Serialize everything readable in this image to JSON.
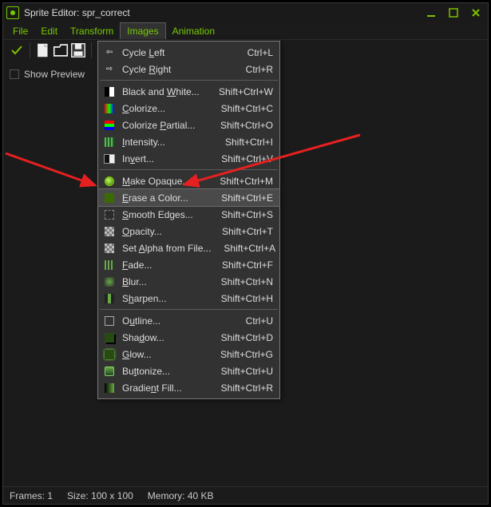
{
  "window": {
    "title": "Sprite Editor: spr_correct"
  },
  "menus": {
    "file": "File",
    "edit": "Edit",
    "transform": "Transform",
    "images": "Images",
    "animation": "Animation"
  },
  "sidebar": {
    "showPreview": "Show Preview"
  },
  "dropdown": {
    "items": [
      {
        "kind": "item",
        "label": "Cycle Left",
        "u": "L",
        "short": "Ctrl+L",
        "icon": "cyc-left"
      },
      {
        "kind": "item",
        "label": "Cycle Right",
        "u": "R",
        "short": "Ctrl+R",
        "icon": "cyc-right"
      },
      {
        "kind": "sep"
      },
      {
        "kind": "item",
        "label": "Black and White...",
        "u": "W",
        "short": "Shift+Ctrl+W",
        "icon": "bw"
      },
      {
        "kind": "item",
        "label": "Colorize...",
        "u": "C",
        "short": "Shift+Ctrl+C",
        "icon": "grad"
      },
      {
        "kind": "item",
        "label": "Colorize Partial...",
        "u": "P",
        "short": "Shift+Ctrl+O",
        "icon": "rgb"
      },
      {
        "kind": "item",
        "label": "Intensity...",
        "u": "I",
        "short": "Shift+Ctrl+I",
        "icon": "bars"
      },
      {
        "kind": "item",
        "label": "Invert...",
        "u": "v",
        "short": "Shift+Ctrl+V",
        "icon": "inv"
      },
      {
        "kind": "sep"
      },
      {
        "kind": "item",
        "label": "Make Opaque...",
        "u": "M",
        "short": "Shift+Ctrl+M",
        "icon": "circ"
      },
      {
        "kind": "item",
        "label": "Erase a Color...",
        "u": "E",
        "short": "Shift+Ctrl+E",
        "icon": "green",
        "hl": true
      },
      {
        "kind": "item",
        "label": "Smooth Edges...",
        "u": "S",
        "short": "Shift+Ctrl+S",
        "icon": "sm"
      },
      {
        "kind": "item",
        "label": "Opacity...",
        "u": "O",
        "short": "Shift+Ctrl+T",
        "icon": "alpha"
      },
      {
        "kind": "item",
        "label": "Set Alpha from File...",
        "u": "A",
        "short": "Shift+Ctrl+A",
        "icon": "alpha"
      },
      {
        "kind": "item",
        "label": "Fade...",
        "u": "F",
        "short": "Shift+Ctrl+F",
        "icon": "fade"
      },
      {
        "kind": "item",
        "label": "Blur...",
        "u": "B",
        "short": "Shift+Ctrl+N",
        "icon": "blur"
      },
      {
        "kind": "item",
        "label": "Sharpen...",
        "u": "h",
        "short": "Shift+Ctrl+H",
        "icon": "sharp"
      },
      {
        "kind": "sep"
      },
      {
        "kind": "item",
        "label": "Outline...",
        "u": "u",
        "short": "Ctrl+U",
        "icon": "outl"
      },
      {
        "kind": "item",
        "label": "Shadow...",
        "u": "d",
        "short": "Shift+Ctrl+D",
        "icon": "shad"
      },
      {
        "kind": "item",
        "label": "Glow...",
        "u": "G",
        "short": "Shift+Ctrl+G",
        "icon": "glow"
      },
      {
        "kind": "item",
        "label": "Buttonize...",
        "u": "t",
        "short": "Shift+Ctrl+U",
        "icon": "btn"
      },
      {
        "kind": "item",
        "label": "Gradient Fill...",
        "u": "n",
        "short": "Shift+Ctrl+R",
        "icon": "gfill"
      }
    ]
  },
  "status": {
    "frames_label": "Frames:",
    "frames_value": "1",
    "size_label": "Size:",
    "size_value": "100 x 100",
    "mem_label": "Memory:",
    "mem_value": "40 KB"
  },
  "colors": {
    "accent": "#7fc000"
  }
}
